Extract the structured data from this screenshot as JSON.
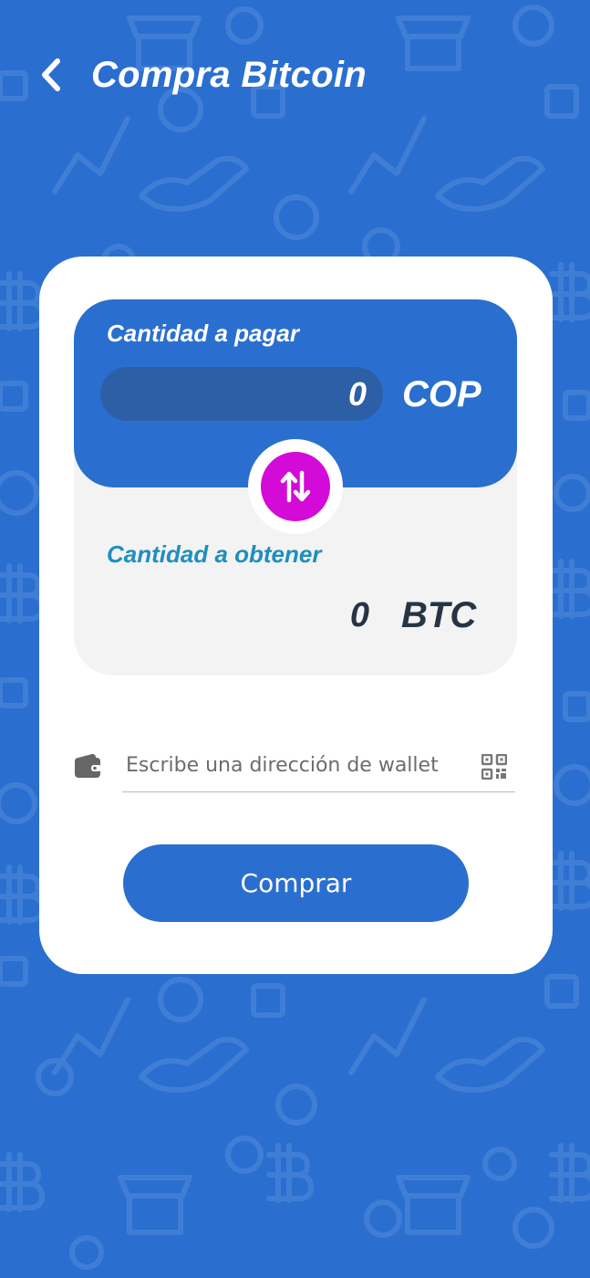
{
  "header": {
    "title": "Compra Bitcoin",
    "back_icon": "chevron-left-icon"
  },
  "exchange": {
    "pay_label": "Cantidad a pagar",
    "pay_amount": "0",
    "pay_currency": "COP",
    "swap_icon": "swap-vertical-icon",
    "get_label": "Cantidad a obtener",
    "get_amount": "0",
    "get_currency": "BTC"
  },
  "wallet": {
    "icon": "wallet-icon",
    "placeholder": "Escribe una dirección de wallet",
    "value": "",
    "qr_icon": "qr-code-icon"
  },
  "actions": {
    "buy_label": "Comprar"
  },
  "colors": {
    "background": "#2a6fcf",
    "card": "#ffffff",
    "pay_input": "#2c5fa5",
    "swap_button": "#d40ad8",
    "get_label": "#1d8fbf",
    "dark_text": "#263545"
  }
}
